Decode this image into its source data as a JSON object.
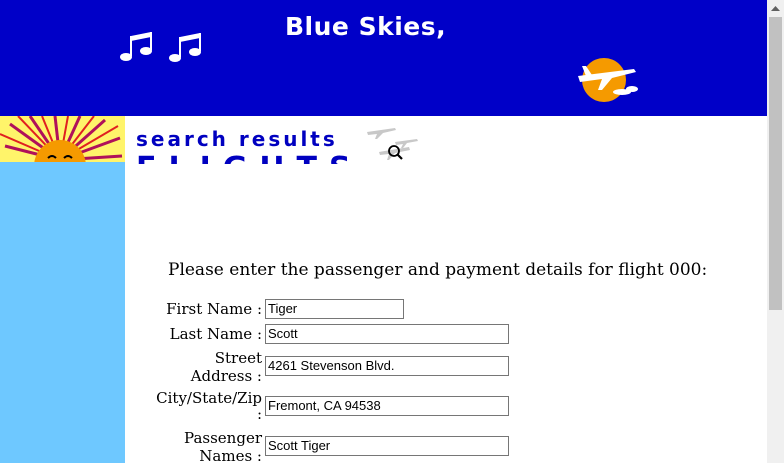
{
  "banner": {
    "title": "Blue Skies,"
  },
  "subheader": {
    "search_results": "search results",
    "flights": "FLIGHTS"
  },
  "form": {
    "intro": "Please enter the passenger and payment details for flight 000:",
    "first_name": {
      "label": "First Name :",
      "value": "Tiger"
    },
    "last_name": {
      "label": "Last Name :",
      "value": "Scott"
    },
    "street": {
      "label_line1": "Street",
      "label_line2": "Address :",
      "value": "4261 Stevenson Blvd."
    },
    "city": {
      "label_line1": "City/State/Zip",
      "label_line2": ":",
      "value": "Fremont, CA 94538"
    },
    "passengers": {
      "label_line1": "Passenger",
      "label_line2": "Names :",
      "value": "Scott Tiger"
    }
  },
  "colors": {
    "banner": "#0000c8",
    "sidebar": "#6ec8ff",
    "heading": "#0000c0",
    "sun": "#f59a00"
  },
  "icons": [
    "music-notes-icon",
    "airplane-sun-logo-icon",
    "sun-icon",
    "magnifier-icon",
    "scroll-up-arrow-icon"
  ]
}
